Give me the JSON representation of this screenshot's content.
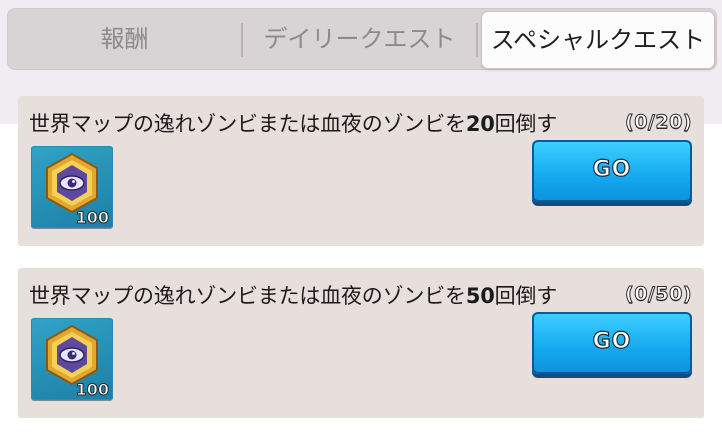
{
  "tabs": [
    {
      "label": "報酬",
      "active": false
    },
    {
      "label": "デイリークエスト",
      "active": false
    },
    {
      "label": "スペシャルクエスト",
      "active": true
    }
  ],
  "quests": [
    {
      "title_prefix": "世界マップの逸れゾンビまたは血夜のゾンビを",
      "target": "20",
      "title_suffix": "回倒す",
      "progress": "(0/20)",
      "reward_icon": "eye-badge-icon",
      "reward_qty": "100",
      "button_label": "GO"
    },
    {
      "title_prefix": "世界マップの逸れゾンビまたは血夜のゾンビを",
      "target": "50",
      "title_suffix": "回倒す",
      "progress": "(0/50)",
      "reward_icon": "eye-badge-icon",
      "reward_qty": "100",
      "button_label": "GO"
    }
  ],
  "colors": {
    "tab_bar": "#d8d3d4",
    "card_bg": "#e6dfdc",
    "go_button": "#14a8f0",
    "reward_bg": "#2590b8"
  }
}
